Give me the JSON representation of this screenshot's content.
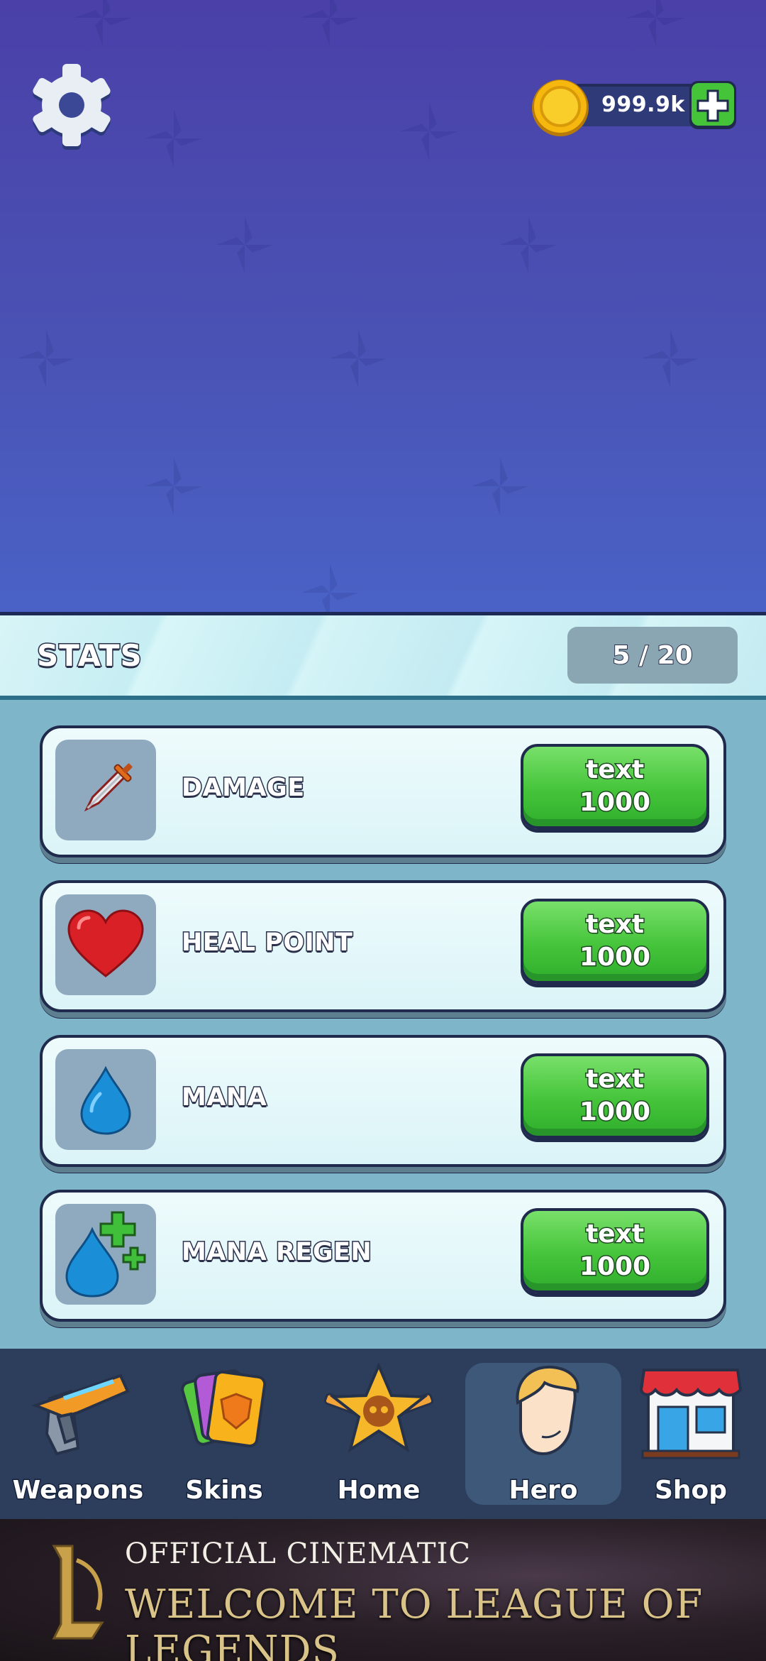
{
  "header": {
    "coins": "999.9k"
  },
  "stats": {
    "title": "STATS",
    "count": "5 / 20",
    "items": [
      {
        "label": "DAMAGE",
        "icon": "sword-icon",
        "button_line1": "text",
        "button_line2": "1000"
      },
      {
        "label": "HEAL POINT",
        "icon": "heart-icon",
        "button_line1": "text",
        "button_line2": "1000"
      },
      {
        "label": "MANA",
        "icon": "mana-drop-icon",
        "button_line1": "text",
        "button_line2": "1000"
      },
      {
        "label": "MANA REGEN",
        "icon": "mana-regen-icon",
        "button_line1": "text",
        "button_line2": "1000"
      }
    ]
  },
  "nav": {
    "items": [
      {
        "label": "Weapons",
        "icon": "gun-icon"
      },
      {
        "label": "Skins",
        "icon": "cards-icon"
      },
      {
        "label": "Home",
        "icon": "star-skull-icon"
      },
      {
        "label": "Hero",
        "icon": "hero-face-icon",
        "active": true
      },
      {
        "label": "Shop",
        "icon": "shop-icon"
      }
    ]
  },
  "ad": {
    "line1": "OFFICIAL CINEMATIC",
    "line2": "WELCOME TO LEAGUE OF LEGENDS"
  },
  "colors": {
    "background": "#4a4fb0",
    "button_green": "#45c43a",
    "panel": "#7fb5c9",
    "nav": "#2c3e5c"
  }
}
